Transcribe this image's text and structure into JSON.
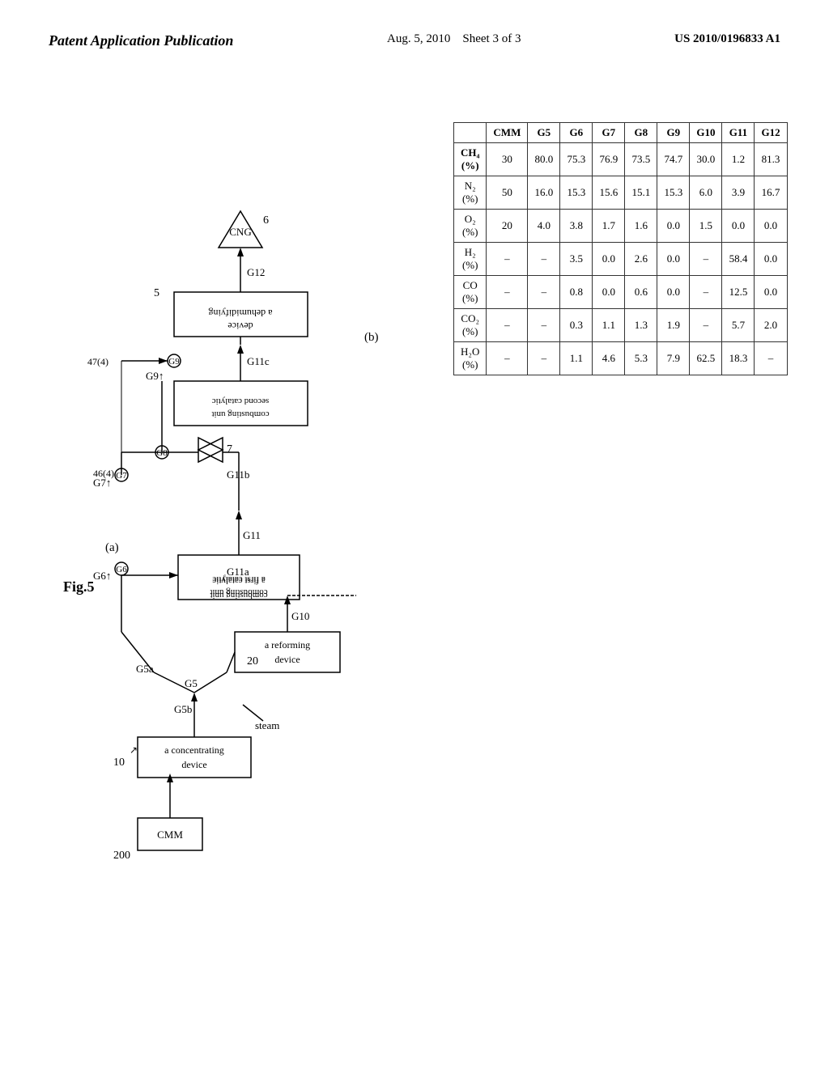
{
  "header": {
    "left": "Patent Application Publication",
    "center_date": "Aug. 5, 2010",
    "center_sheet": "Sheet 3 of 3",
    "right": "US 2010/0196833 A1"
  },
  "fig": {
    "label": "Fig.5",
    "sub_a": "(a)",
    "sub_b": "(b)"
  },
  "table": {
    "columns": [
      "",
      "CMM",
      "G5",
      "G6",
      "G7",
      "G8",
      "G9",
      "G10",
      "G11",
      "G12"
    ],
    "rows": [
      {
        "label": "CH₄ (%)",
        "cmm": "30",
        "g5": "80.0",
        "g6": "75.3",
        "g7": "76.9",
        "g8": "73.5",
        "g9": "74.7",
        "g10": "30.0",
        "g11": "1.2",
        "g12": "81.3"
      },
      {
        "label": "N₂ (%)",
        "cmm": "50",
        "g5": "16.0",
        "g6": "15.3",
        "g7": "15.6",
        "g8": "15.1",
        "g9": "15.3",
        "g10": "6.0",
        "g11": "3.9",
        "g12": "16.7"
      },
      {
        "label": "O₂ (%)",
        "cmm": "20",
        "g5": "4.0",
        "g6": "3.8",
        "g7": "1.7",
        "g8": "1.6",
        "g9": "0.0",
        "g10": "1.5",
        "g11": "0.0",
        "g12": "0.0"
      },
      {
        "label": "H₂ (%)",
        "cmm": "–",
        "g5": "–",
        "g6": "3.5",
        "g7": "0.0",
        "g8": "2.6",
        "g9": "0.0",
        "g10": "–",
        "g11": "58.4",
        "g12": "0.0"
      },
      {
        "label": "CO (%)",
        "cmm": "–",
        "g5": "–",
        "g6": "0.8",
        "g7": "0.0",
        "g8": "0.6",
        "g9": "0.0",
        "g10": "–",
        "g11": "12.5",
        "g12": "0.0"
      },
      {
        "label": "CO₂ (%)",
        "cmm": "–",
        "g5": "–",
        "g6": "0.3",
        "g7": "1.1",
        "g8": "1.3",
        "g9": "1.9",
        "g10": "–",
        "g11": "5.7",
        "g12": "2.0"
      },
      {
        "label": "H₂O (%)",
        "cmm": "–",
        "g5": "–",
        "g6": "1.1",
        "g7": "4.6",
        "g8": "5.3",
        "g9": "7.9",
        "g10": "62.5",
        "g11": "18.3",
        "g12": "–"
      }
    ]
  }
}
